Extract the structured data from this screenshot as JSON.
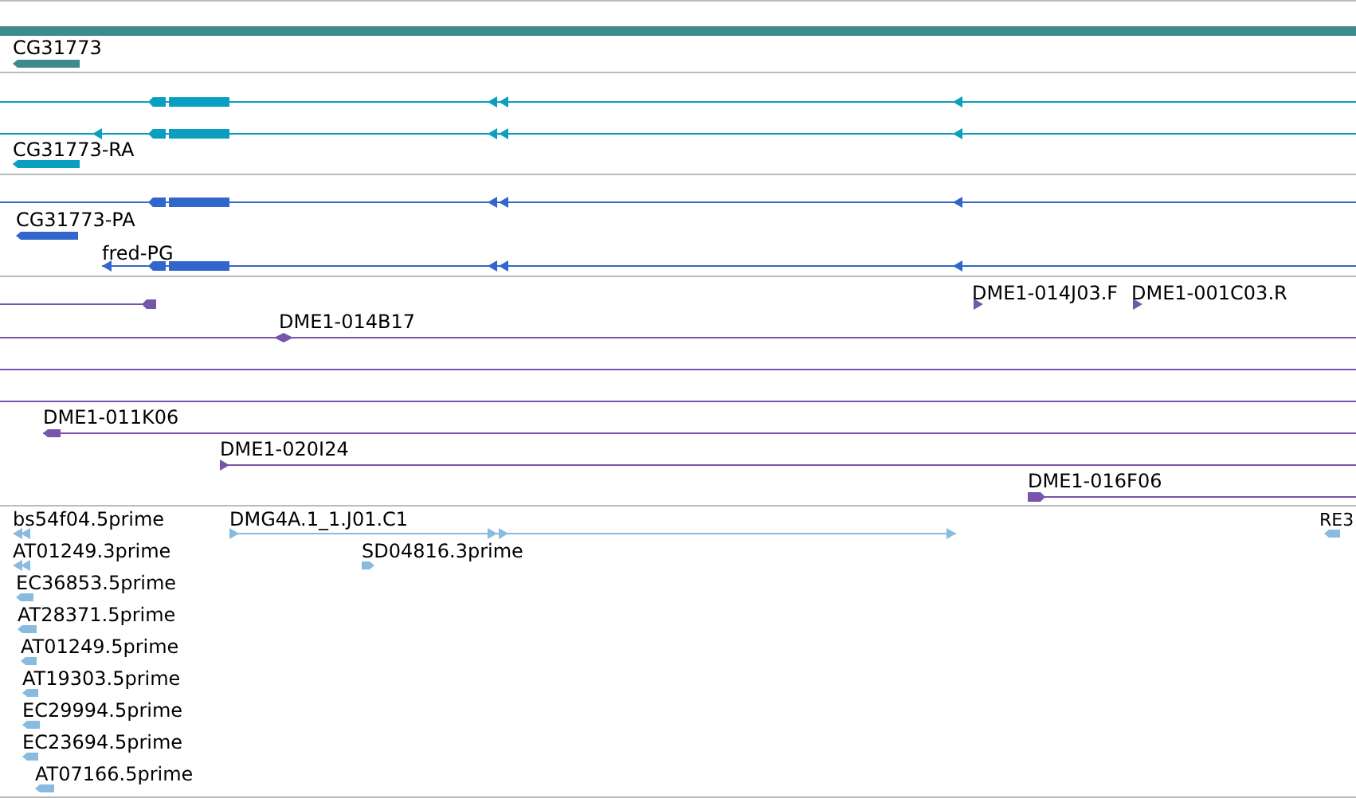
{
  "tracks": [
    {
      "kind": "gene",
      "features": [
        {
          "kind": "bar"
        },
        {
          "kind": "feature",
          "label": "CG31773",
          "reverse": true
        }
      ]
    },
    {
      "kind": "mrna",
      "features": [
        {
          "kind": "feature",
          "reverse": true
        },
        {
          "kind": "feature",
          "reverse": true
        },
        {
          "kind": "feature",
          "label": "CG31773-RA",
          "reverse": true
        }
      ]
    },
    {
      "kind": "protein",
      "features": [
        {
          "kind": "feature",
          "reverse": true
        },
        {
          "kind": "feature",
          "label": "CG31773-PA",
          "reverse": true
        },
        {
          "kind": "feature",
          "label": "fred-PG",
          "reverse": true
        }
      ]
    },
    {
      "kind": "clone",
      "features": [
        {
          "kind": "feature",
          "reverse": true
        },
        {
          "kind": "feature",
          "label": "DME1-014J03.F",
          "reverse": false
        },
        {
          "kind": "feature",
          "label": "DME1-001C03.R",
          "reverse": false
        },
        {
          "kind": "feature",
          "label": "DME1-014B17"
        },
        {
          "kind": "line"
        },
        {
          "kind": "line"
        },
        {
          "kind": "feature",
          "label": "DME1-011K06",
          "reverse": true
        },
        {
          "kind": "feature",
          "label": "DME1-020I24",
          "reverse": false
        },
        {
          "kind": "feature",
          "label": "DME1-016F06",
          "reverse": false
        }
      ]
    },
    {
      "kind": "est",
      "features": [
        {
          "kind": "feature",
          "label": "bs54f04.5prime",
          "reverse": true
        },
        {
          "kind": "feature",
          "label": "AT01249.3prime",
          "reverse": true
        },
        {
          "kind": "feature",
          "label": "EC36853.5prime",
          "reverse": true
        },
        {
          "kind": "feature",
          "label": "AT28371.5prime",
          "reverse": true
        },
        {
          "kind": "feature",
          "label": "AT01249.5prime",
          "reverse": true
        },
        {
          "kind": "feature",
          "label": "AT19303.5prime",
          "reverse": true
        },
        {
          "kind": "feature",
          "label": "EC29994.5prime",
          "reverse": true
        },
        {
          "kind": "feature",
          "label": "EC23694.5prime",
          "reverse": true
        },
        {
          "kind": "feature",
          "label": "AT07166.5prime",
          "reverse": true
        },
        {
          "kind": "feature",
          "label": "DMG4A.1_1.J01.C1",
          "reverse": false
        },
        {
          "kind": "feature",
          "label": "SD04816.3prime",
          "reverse": false
        },
        {
          "kind": "feature",
          "label": "RE3",
          "reverse": true
        }
      ]
    }
  ]
}
